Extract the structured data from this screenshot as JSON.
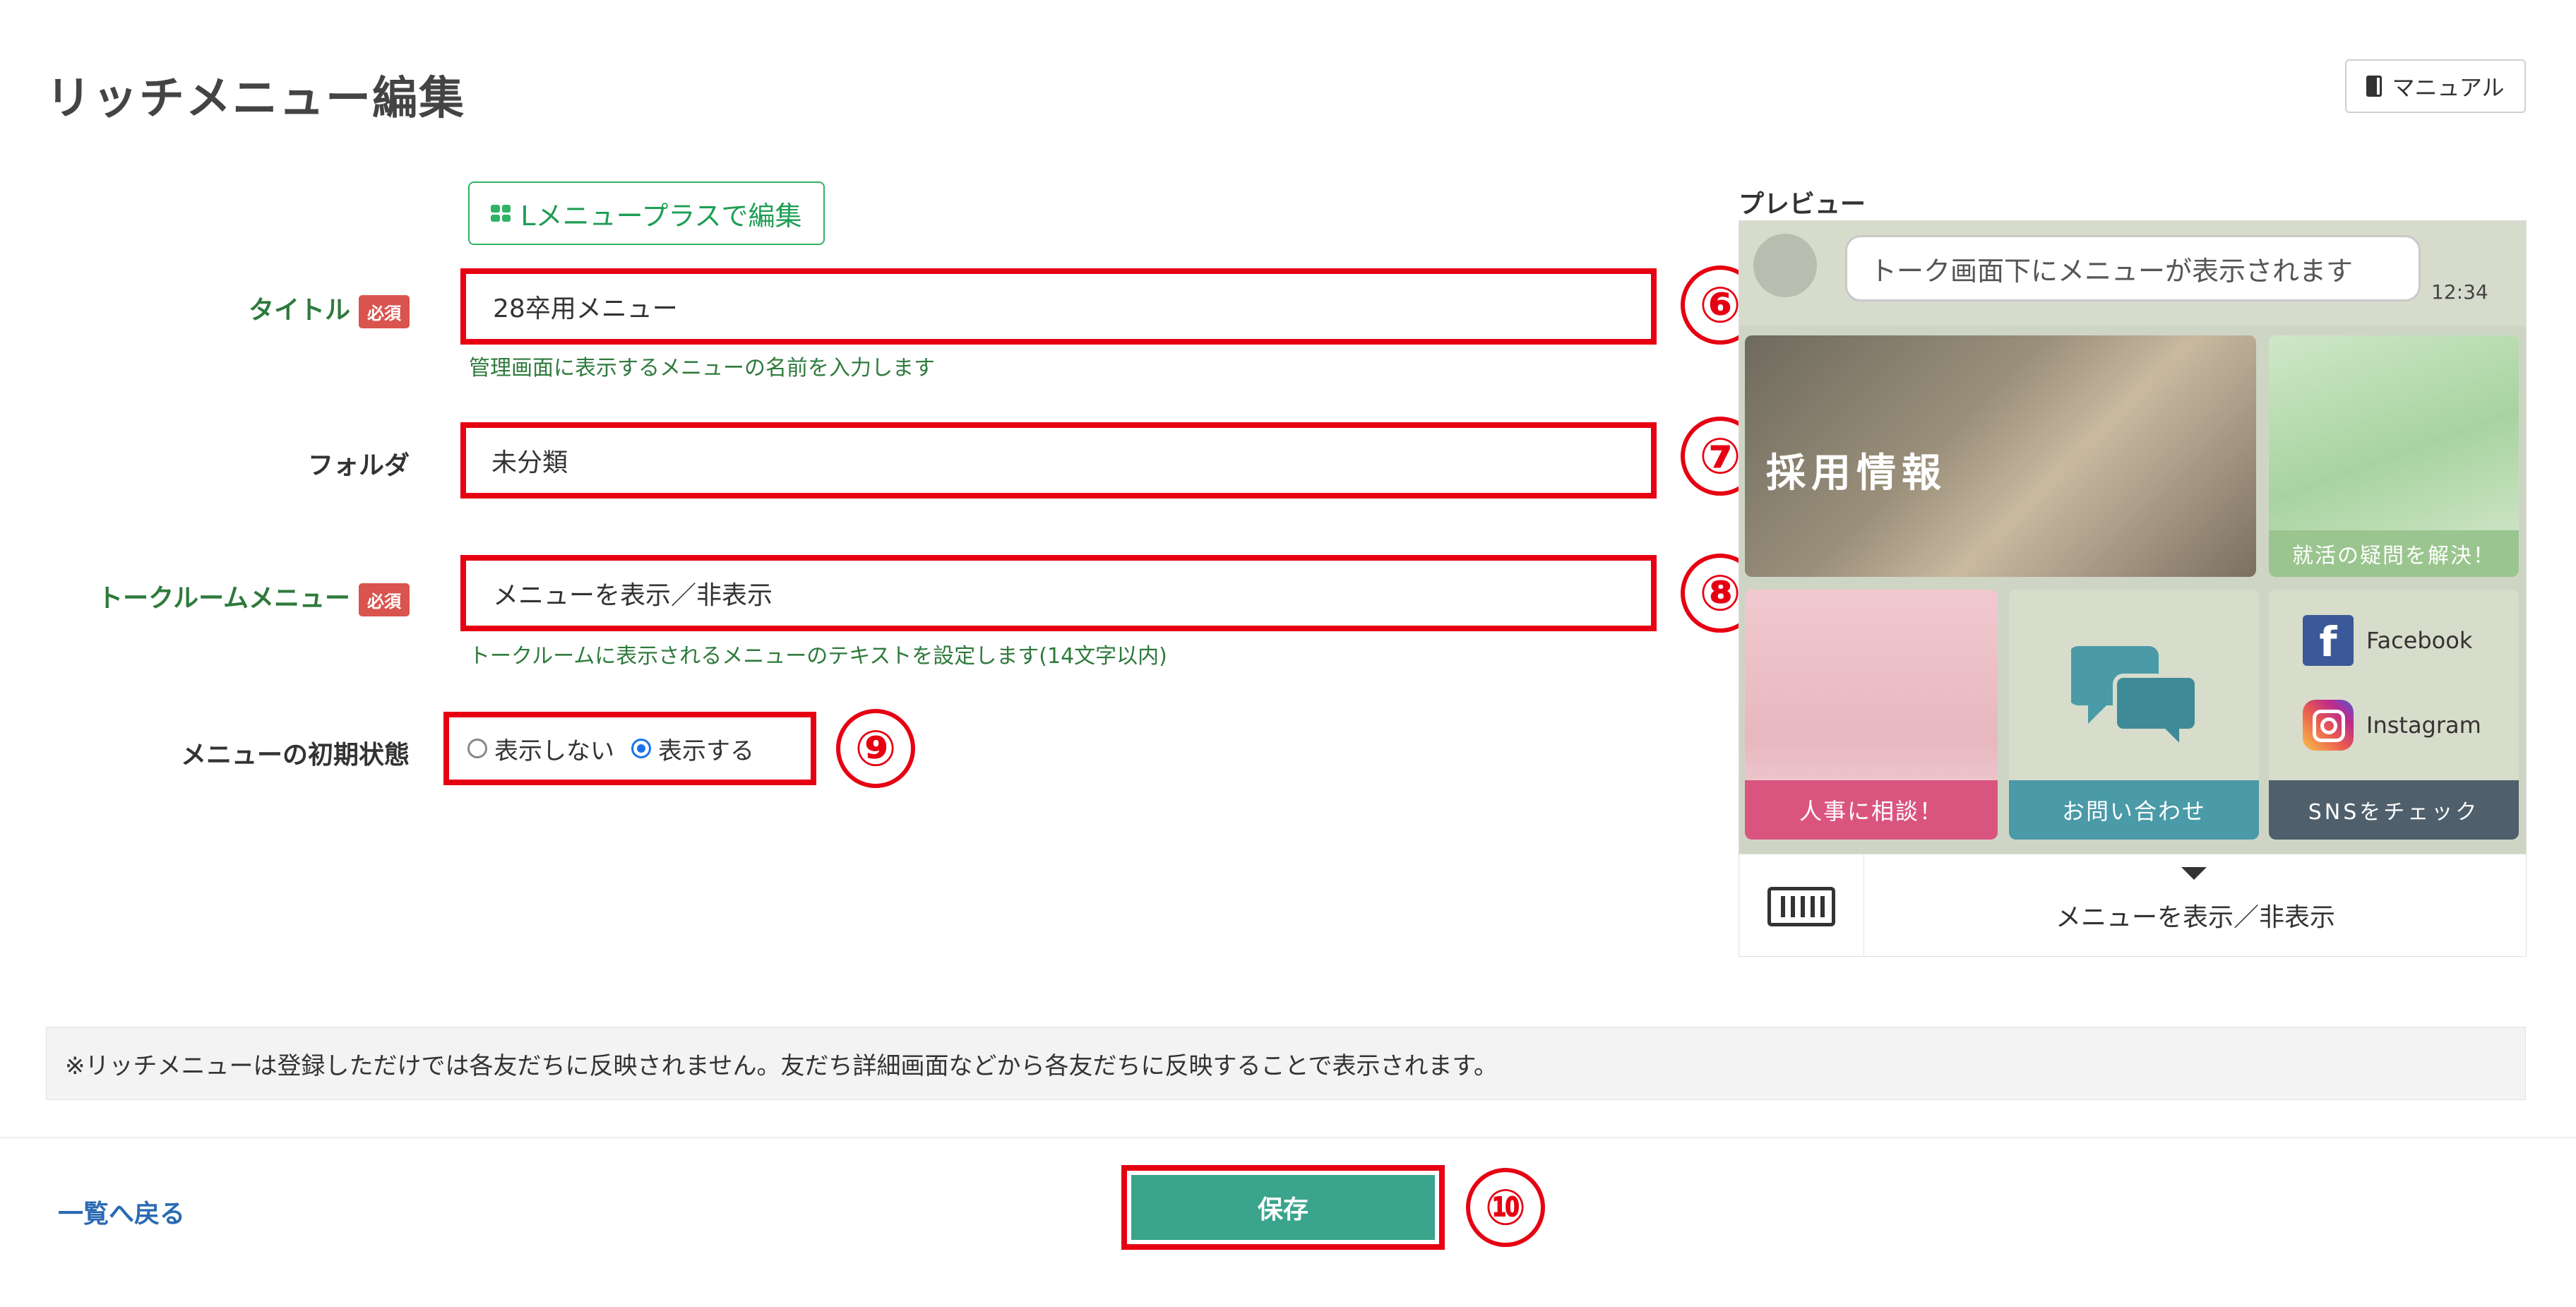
{
  "header": {
    "title": "リッチメニュー編集",
    "manual_label": "マニュアル"
  },
  "toolbar": {
    "lmenu_label": "Lメニュープラスで編集"
  },
  "form": {
    "required_badge": "必須",
    "title_label": "タイトル",
    "title_value": "28卒用メニュー",
    "title_help": "管理画面に表示するメニューの名前を入力します",
    "folder_label": "フォルダ",
    "folder_value": "未分類",
    "talkroom_label": "トークルームメニュー",
    "talkroom_value": "メニューを表示／非表示",
    "talkroom_help": "トークルームに表示されるメニューのテキストを設定します(14文字以内)",
    "initial_label": "メニューの初期状態",
    "option_hide": "表示しない",
    "option_show": "表示する",
    "selected": "表示する"
  },
  "annotations": [
    "⑥",
    "⑦",
    "⑧",
    "⑨",
    "⑩"
  ],
  "preview": {
    "label": "プレビュー",
    "bubble_text": "トーク画面下にメニューが表示されます",
    "time": "12:34",
    "tile_recruit_text": "採用情報",
    "tile_question_caption": "就活の疑問を解決！",
    "tile_consult_caption": "人事に相談！",
    "tile_contact_caption": "お問い合わせ",
    "facebook_label": "Facebook",
    "instagram_label": "Instagram",
    "tile_sns_caption": "SNSをチェック",
    "menu_toggle_text": "メニューを表示／非表示"
  },
  "notice": "※リッチメニューは登録しただけでは各友だちに反映されません。友だち詳細画面などから各友だちに反映することで表示されます。",
  "footer": {
    "back_label": "一覧へ戻る",
    "save_label": "保存"
  },
  "colors": {
    "highlight": "#e60012",
    "green_accent": "#2fb364",
    "save_button": "#3aa48c",
    "link": "#2a6ab2"
  }
}
